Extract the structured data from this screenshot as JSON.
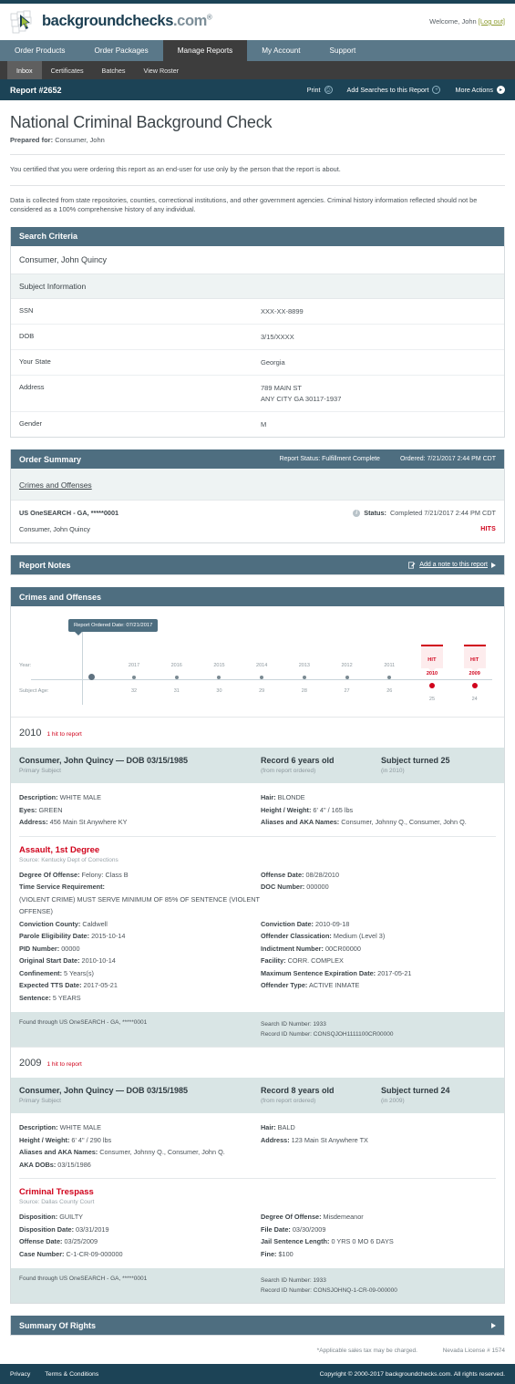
{
  "brand": {
    "name_main": "backgroundchecks",
    "name_dim": ".com",
    "registered": "®"
  },
  "header": {
    "welcome_prefix": "Welcome, John ",
    "logout_label": "[Log out]"
  },
  "mainnav": [
    {
      "label": "Order Products",
      "active": false
    },
    {
      "label": "Order Packages",
      "active": false
    },
    {
      "label": "Manage Reports",
      "active": true
    },
    {
      "label": "My Account",
      "active": false
    },
    {
      "label": "Support",
      "active": false
    }
  ],
  "subnav": [
    {
      "label": "Inbox",
      "active": true
    },
    {
      "label": "Certificates",
      "active": false
    },
    {
      "label": "Batches",
      "active": false
    },
    {
      "label": "View Roster",
      "active": false
    }
  ],
  "reportbar": {
    "title": "Report #2652",
    "print_label": "Print",
    "add_searches_label": "Add Searches to this Report",
    "more_actions_label": "More Actions"
  },
  "doc": {
    "title": "National Criminal Background Check",
    "prepared_label": "Prepared for:",
    "prepared_value": " Consumer, John",
    "certification": "You certified that you were ordering this report as an end-user for use only by the person that the report is about.",
    "disclaimer": "Data is collected from state repositories, counties, correctional institutions, and other government agencies. Criminal history information reflected should not be considered as a 100% comprehensive history of any individual."
  },
  "search_criteria": {
    "panel_title": "Search Criteria",
    "subject_name": "Consumer, John Quincy",
    "subject_info_label": "Subject Information",
    "rows": [
      {
        "label": "SSN",
        "value": "XXX-XX-8899"
      },
      {
        "label": "DOB",
        "value": "3/15/XXXX"
      },
      {
        "label": "Your State",
        "value": "Georgia"
      },
      {
        "label": "Address",
        "value": "789 MAIN ST\nANY CITY GA 30117-1937"
      },
      {
        "label": "Gender",
        "value": "M"
      }
    ]
  },
  "order_summary": {
    "panel_title": "Order Summary",
    "report_status": "Report Status: Fulfillment Complete",
    "ordered": "Ordered: 7/21/2017 2:44 PM CDT",
    "section_link": "Crimes and Offenses",
    "search_name": "US OneSEARCH - GA, *****0001",
    "status_label": "Status:",
    "status_value": " Completed 7/21/2017 2:44 PM CDT",
    "subject_line": "Consumer, John Quincy",
    "hits_badge": "HITS"
  },
  "report_notes": {
    "panel_title": "Report Notes",
    "add_note_label": "Add a note to this report"
  },
  "crimes_panel": {
    "panel_title": "Crimes and Offenses"
  },
  "chart_data": {
    "type": "timeline",
    "title": "Crimes and Offenses",
    "callout": "Report Ordered Date: 07/21/2017",
    "row_labels": {
      "year": "Year:",
      "age": "Subject Age:"
    },
    "categories": [
      "2017",
      "2016",
      "2015",
      "2014",
      "2013",
      "2012",
      "2011",
      "2010",
      "2009"
    ],
    "ages": [
      32,
      31,
      30,
      29,
      28,
      27,
      26,
      25,
      24
    ],
    "hit_years": [
      "2010",
      "2009"
    ],
    "hit_flag_label": "HIT",
    "origin_marker": "report-ordered",
    "hit_color": "#d0021b",
    "axis_color": "#c9d4da",
    "dot_color": "#7a8a92"
  },
  "records": [
    {
      "year": "2010",
      "hits_text": "1 hit to report",
      "subject_title": "Consumer, John Quincy — DOB 03/15/1985",
      "subject_role": "Primary Subject",
      "record_age": "Record 6 years old",
      "record_age_sub": "(from report ordered)",
      "subject_turned": "Subject turned 25",
      "subject_turned_sub": "(in 2010)",
      "profile_left": [
        {
          "label": "Description:",
          "value": " WHITE MALE"
        },
        {
          "label": "Eyes:",
          "value": " GREEN"
        },
        {
          "label": "Address:",
          "value": " 456 Main St Anywhere KY"
        }
      ],
      "profile_right": [
        {
          "label": "Hair:",
          "value": " BLONDE"
        },
        {
          "label": "Height / Weight:",
          "value": " 6' 4\" / 165 lbs"
        },
        {
          "label": "Aliases and AKA Names:",
          "value": "  Consumer, Johnny Q., Consumer, John Q."
        }
      ],
      "offense_title": "Assault, 1st Degree",
      "offense_source": "Source: Kentucky Dept of Corrections",
      "offense_left": [
        {
          "label": "Degree Of Offense:",
          "value": " Felony: Class B"
        },
        {
          "label": "Time Service Requirement:",
          "value": ""
        },
        {
          "label": "",
          "value": "(VIOLENT CRIME) MUST SERVE MINIMUM OF 85% OF SENTENCE (VIOLENT OFFENSE)"
        },
        {
          "label": "Conviction County:",
          "value": " Caldwell"
        },
        {
          "label": "Parole Eligibility Date:",
          "value": " 2015-10-14"
        },
        {
          "label": "PID Number:",
          "value": " 00000"
        },
        {
          "label": "Original Start Date:",
          "value": " 2010-10-14"
        },
        {
          "label": "Confinement:",
          "value": " 5 Years(s)"
        },
        {
          "label": "Expected TTS Date:",
          "value": " 2017-05-21"
        },
        {
          "label": "Sentence:",
          "value": " 5 YEARS"
        }
      ],
      "offense_right": [
        {
          "label": "Offense Date:",
          "value": " 08/28/2010"
        },
        {
          "label": "DOC Number:",
          "value": " 000000"
        },
        {
          "label": "",
          "value": ""
        },
        {
          "label": "",
          "value": ""
        },
        {
          "label": "Conviction Date:",
          "value": " 2010-09-18"
        },
        {
          "label": "Offender Classication:",
          "value": " Medium (Level 3)"
        },
        {
          "label": "Indictment Number:",
          "value": " 00CR00000"
        },
        {
          "label": "Facility:",
          "value": " CORR. COMPLEX"
        },
        {
          "label": "Maximum Sentence Expiration Date:",
          "value": " 2017-05-21"
        },
        {
          "label": "Offender Type:",
          "value": " ACTIVE INMATE"
        }
      ],
      "found_through": "Found through US OneSEARCH - GA, *****0001",
      "search_id": "Search ID Number: 1933",
      "record_id": "Record ID Number: CONSQJOH1111100CR00000"
    },
    {
      "year": "2009",
      "hits_text": "1 hit to report",
      "subject_title": "Consumer, John Quincy — DOB 03/15/1985",
      "subject_role": "Primary Subject",
      "record_age": "Record 8 years old",
      "record_age_sub": "(from report ordered)",
      "subject_turned": "Subject turned 24",
      "subject_turned_sub": "(in 2009)",
      "profile_left": [
        {
          "label": "Description:",
          "value": " WHITE MALE"
        },
        {
          "label": "Height / Weight:",
          "value": " 6' 4\" / 290 lbs"
        },
        {
          "label": "Aliases and AKA Names:",
          "value": "  Consumer, Johnny Q., Consumer, John Q."
        },
        {
          "label": "AKA DOBs:",
          "value": "  03/15/1986"
        }
      ],
      "profile_right": [
        {
          "label": "Hair:",
          "value": " BALD"
        },
        {
          "label": "Address:",
          "value": " 123 Main St Anywhere TX"
        }
      ],
      "offense_title": "Criminal Trespass",
      "offense_source": "Source: Dallas County Court",
      "offense_left": [
        {
          "label": "Disposition:",
          "value": " GUILTY"
        },
        {
          "label": "Disposition Date:",
          "value": " 03/31/2019"
        },
        {
          "label": "Offense Date:",
          "value": " 03/25/2009"
        },
        {
          "label": "Case Number:",
          "value": " C-1-CR-09-000000"
        }
      ],
      "offense_right": [
        {
          "label": "Degree Of Offense:",
          "value": " Misdemeanor"
        },
        {
          "label": "File Date:",
          "value": " 03/30/2009"
        },
        {
          "label": "Jail Sentence Length:",
          "value": " 0 YRS 0 MO 6 DAYS"
        },
        {
          "label": "Fine:",
          "value": " $100"
        }
      ],
      "found_through": "Found through US OneSEARCH - GA, *****0001",
      "search_id": "Search ID Number: 1933",
      "record_id": "Record ID Number: CONSJOHNQ-1-CR-09-000000"
    }
  ],
  "summary_of_rights": {
    "panel_title": "Summary Of Rights"
  },
  "legal": {
    "sales_tax": "*Applicable sales tax may be charged.",
    "license": "Nevada License # 1574"
  },
  "footer": {
    "privacy": "Privacy",
    "terms": "Terms & Conditions",
    "copyright": "Copyright © 2000-2017 backgroundchecks.com. All rights reserved."
  }
}
